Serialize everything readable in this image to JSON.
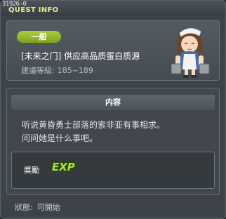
{
  "window": {
    "quest_id": "31926-0",
    "title": "QUEST INFO"
  },
  "quest": {
    "category": "一般",
    "name": "[未来之门] 供应高品质蛋白质源",
    "level_label": "建議等級:",
    "level_range": "185~189"
  },
  "content": {
    "header": "内容",
    "lines": [
      "听说黄昏勇士部落的索非亚有事相求。",
      "问问她是什么事吧。"
    ]
  },
  "reward": {
    "label": "獎勵",
    "exp_text": "EXP"
  },
  "status": {
    "label": "狀態:",
    "value": "可開始"
  },
  "colors": {
    "title": "#f0e68a",
    "category_pill": "#8fb629",
    "exp": "#a6e83a",
    "background": "#3d4349"
  },
  "icons": {
    "npc": "nurse-npc-portrait",
    "exp": "exp-reward-icon"
  }
}
